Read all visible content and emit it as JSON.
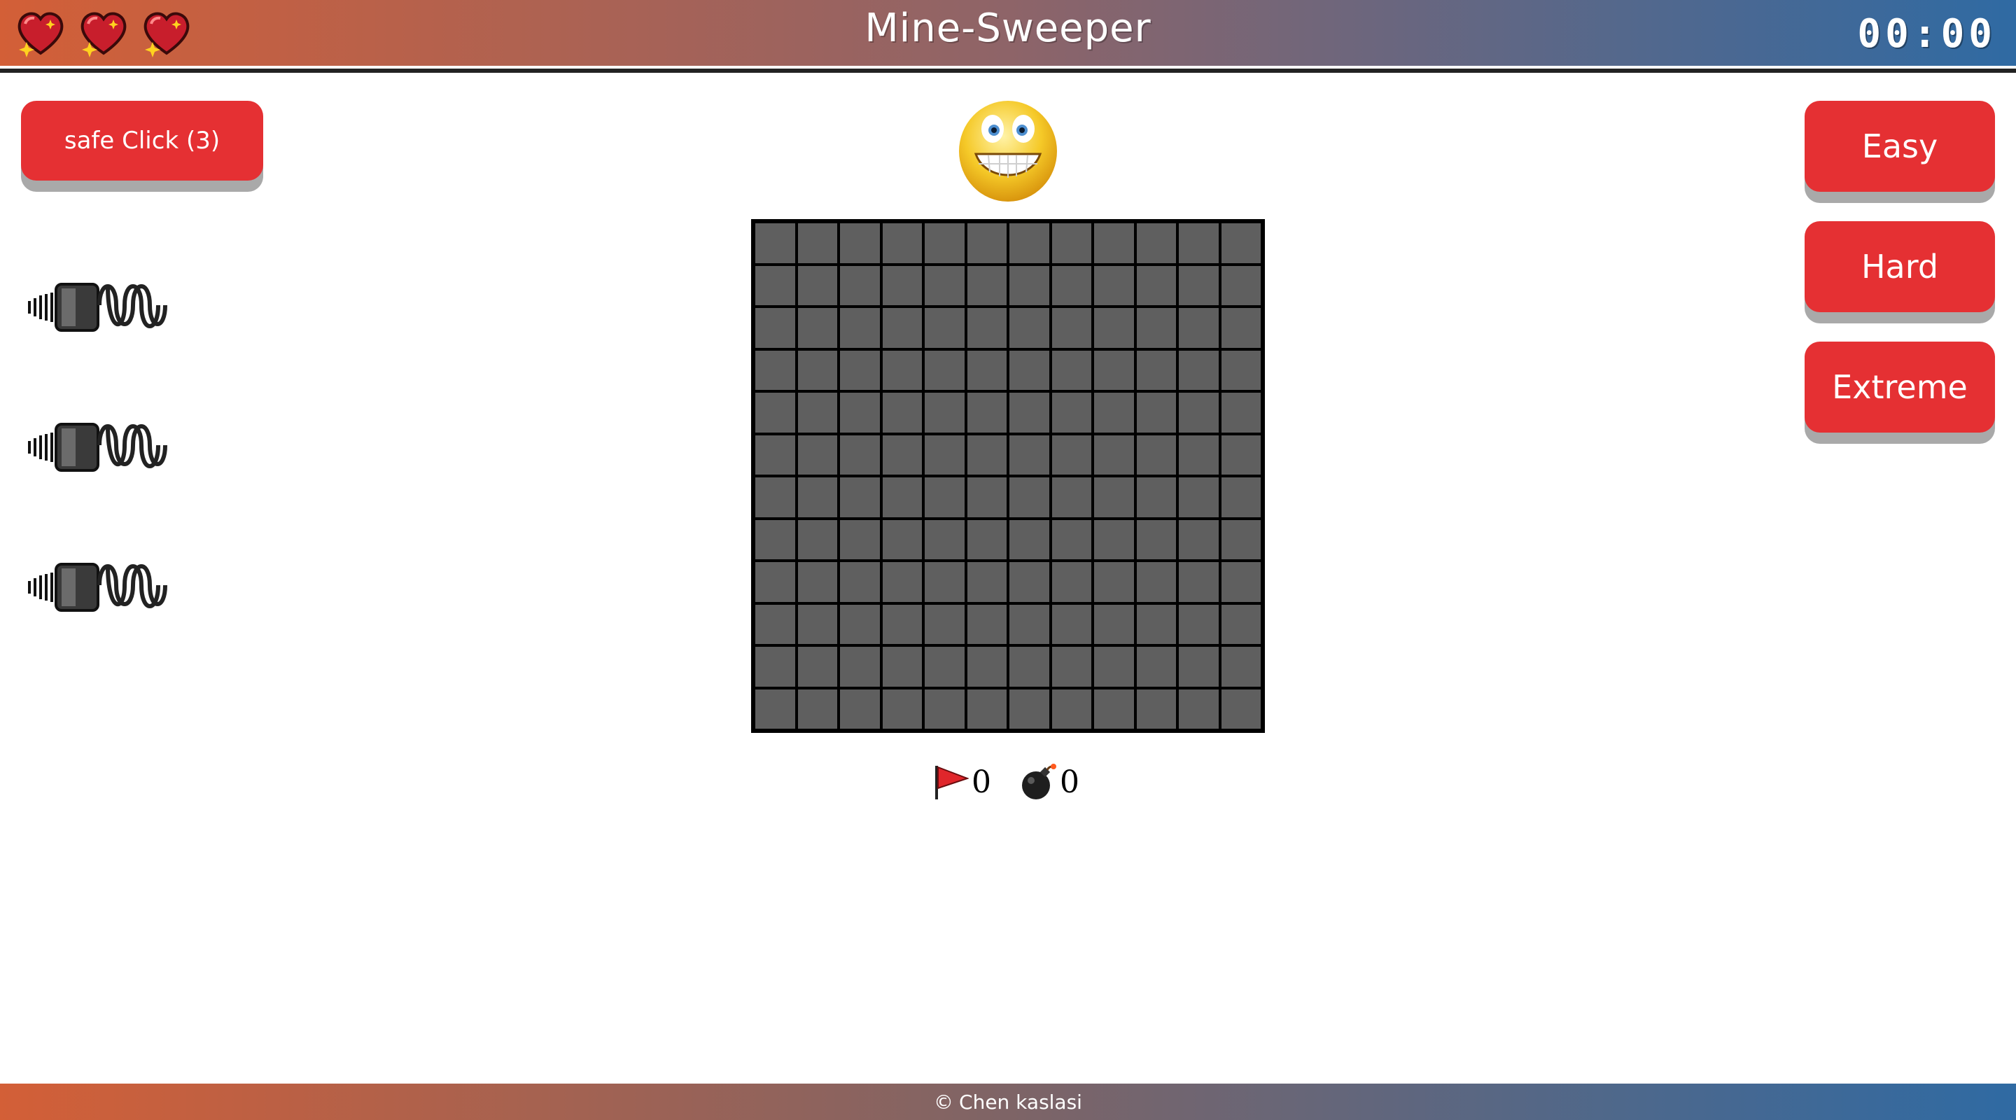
{
  "header": {
    "title": "Mine-Sweeper",
    "timer": "00:00",
    "lives": [
      "heart-icon",
      "heart-icon",
      "heart-icon"
    ]
  },
  "controls": {
    "safe_click_label": "safe Click (3)",
    "hints": [
      "lightbulb-icon",
      "lightbulb-icon",
      "lightbulb-icon"
    ]
  },
  "difficulty": {
    "easy_label": "Easy",
    "hard_label": "Hard",
    "extreme_label": "Extreme"
  },
  "board": {
    "rows": 12,
    "cols": 12,
    "cell_color": "#5f5f5f"
  },
  "stats": {
    "flags": "0",
    "mines": "0"
  },
  "footer": {
    "copyright_symbol": "©",
    "author": "Chen kaslasi"
  },
  "colors": {
    "accent": "#e53033",
    "gradient_start": "#d35f37",
    "gradient_end": "#2f6aa3"
  }
}
